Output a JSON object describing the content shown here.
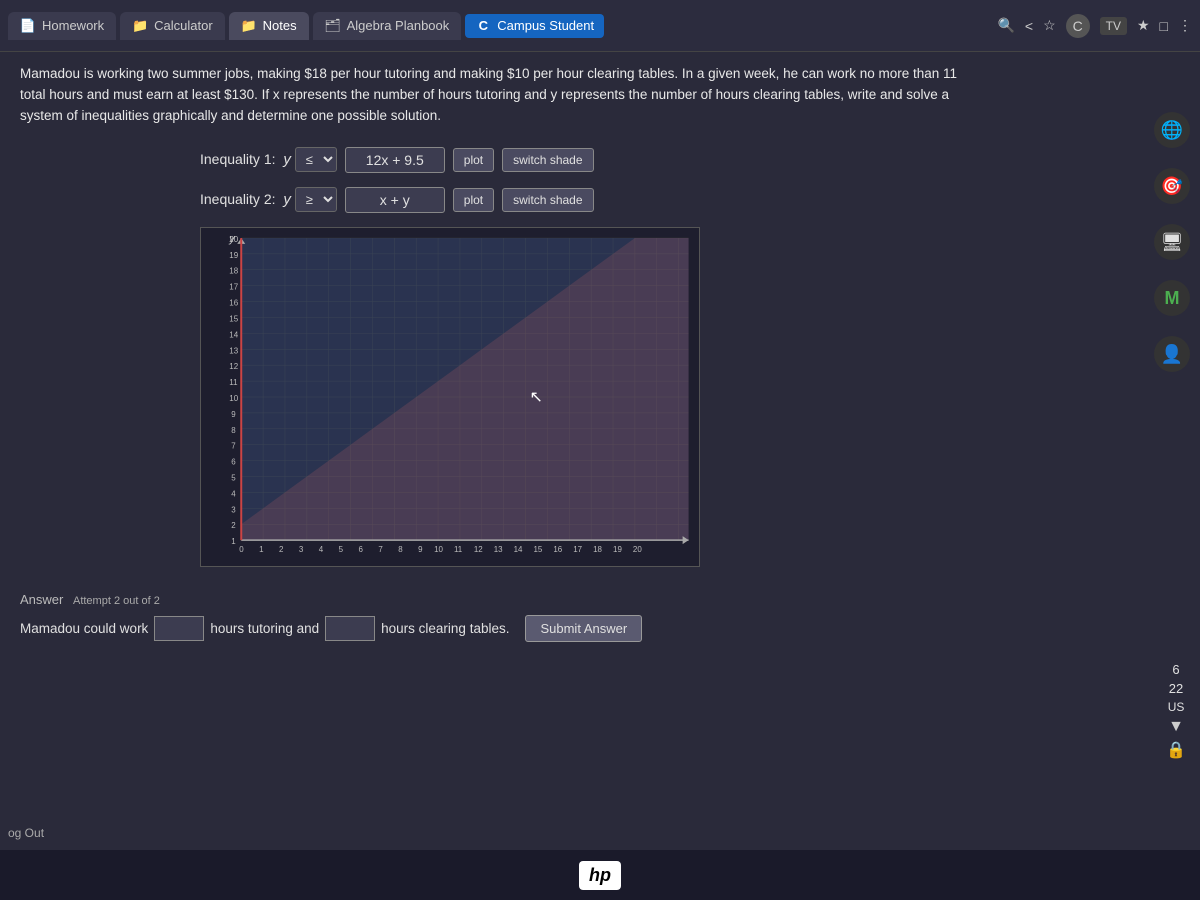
{
  "topbar": {
    "tabs": [
      {
        "label": "Homework",
        "icon": "📄",
        "active": false
      },
      {
        "label": "Calculator",
        "icon": "📁",
        "active": false
      },
      {
        "label": "Notes",
        "icon": "📁",
        "active": true
      },
      {
        "label": "Algebra Planbook",
        "icon": "🗂",
        "active": false
      },
      {
        "label": "Campus Student",
        "icon": "C",
        "active": false,
        "campus": true
      }
    ],
    "right_icons": [
      "🔍",
      "<",
      "☆",
      "C",
      "TV",
      "★",
      "□",
      "⋮"
    ]
  },
  "problem": {
    "text": "Mamadou is working two summer jobs, making $18 per hour tutoring and making $10 per hour clearing tables. In a given week, he can work no more than 11 total hours and must earn at least $130. If x represents the number of hours tutoring and y represents the number of hours clearing tables, write and solve a system of inequalities graphically and determine one possible solution."
  },
  "inequality1": {
    "label": "Inequality 1:",
    "var": "y",
    "sign": "≤",
    "expression": "12x + 9.5",
    "btn_plot": "plot",
    "btn_switch": "switch shade"
  },
  "inequality2": {
    "label": "Inequality 2:",
    "var": "y",
    "sign": "≥",
    "expression": "x + y",
    "btn_plot": "plot",
    "btn_switch": "switch shade"
  },
  "graph": {
    "y_axis_label": "y",
    "y_max": 20,
    "x_max": 20,
    "y_ticks": [
      1,
      2,
      3,
      4,
      5,
      6,
      7,
      8,
      9,
      10,
      11,
      12,
      13,
      14,
      15,
      16,
      17,
      18,
      19,
      20
    ],
    "x_ticks": [
      1,
      2,
      3,
      4,
      5,
      6,
      7,
      8,
      9,
      10,
      11,
      12,
      13,
      14,
      15,
      16,
      17,
      18,
      19,
      20
    ]
  },
  "answer": {
    "label": "Answer",
    "attempt_text": "Attempt 2 out of 2",
    "prefix": "Mamadou could work",
    "input1_value": "",
    "middle_text": "hours tutoring and",
    "input2_value": "",
    "suffix": "hours clearing tables.",
    "btn_submit": "Submit Answer"
  },
  "sidebar": {
    "badge_number": "6",
    "badge_22": "22",
    "badge_us": "US"
  },
  "footer": {
    "logo": "hp"
  },
  "log_out": "og Out"
}
